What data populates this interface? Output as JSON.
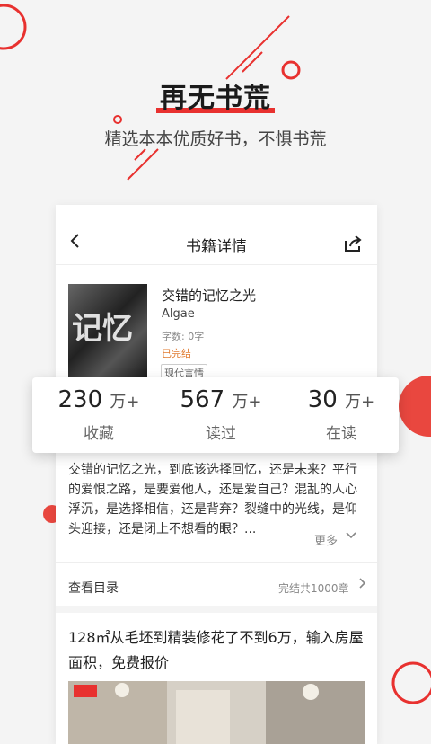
{
  "promo": {
    "title": "再无书荒",
    "subtitle": "精选本本优质好书，不惧书荒"
  },
  "nav": {
    "title": "书籍详情",
    "back_icon": "chevron-left-icon",
    "share_icon": "share-icon"
  },
  "book": {
    "title": "交错的记忆之光",
    "author": "Algae",
    "word_count": "字数: 0字",
    "status": "已完结",
    "tag": "现代言情",
    "description": "交错的记忆之光，到底该选择回忆，还是未来？平行的爱恨之路，是要爱他人，还是爱自己？混乱的人心浮沉，是选择相信，还是背弃？裂缝中的光线，是仰头迎接，还是闭上不想看的眼？...",
    "more_label": "更多"
  },
  "stats": [
    {
      "value": "230",
      "unit": "万+",
      "label": "收藏"
    },
    {
      "value": "567",
      "unit": "万+",
      "label": "读过"
    },
    {
      "value": "30",
      "unit": "万+",
      "label": "在读"
    }
  ],
  "toc": {
    "label": "查看目录",
    "count": "完结共1000章"
  },
  "ad": {
    "text": "128㎡从毛坯到精装修花了不到6万，输入房屋面积，免费报价"
  },
  "colors": {
    "accent": "#e8312f",
    "status": "#e07a2e"
  }
}
